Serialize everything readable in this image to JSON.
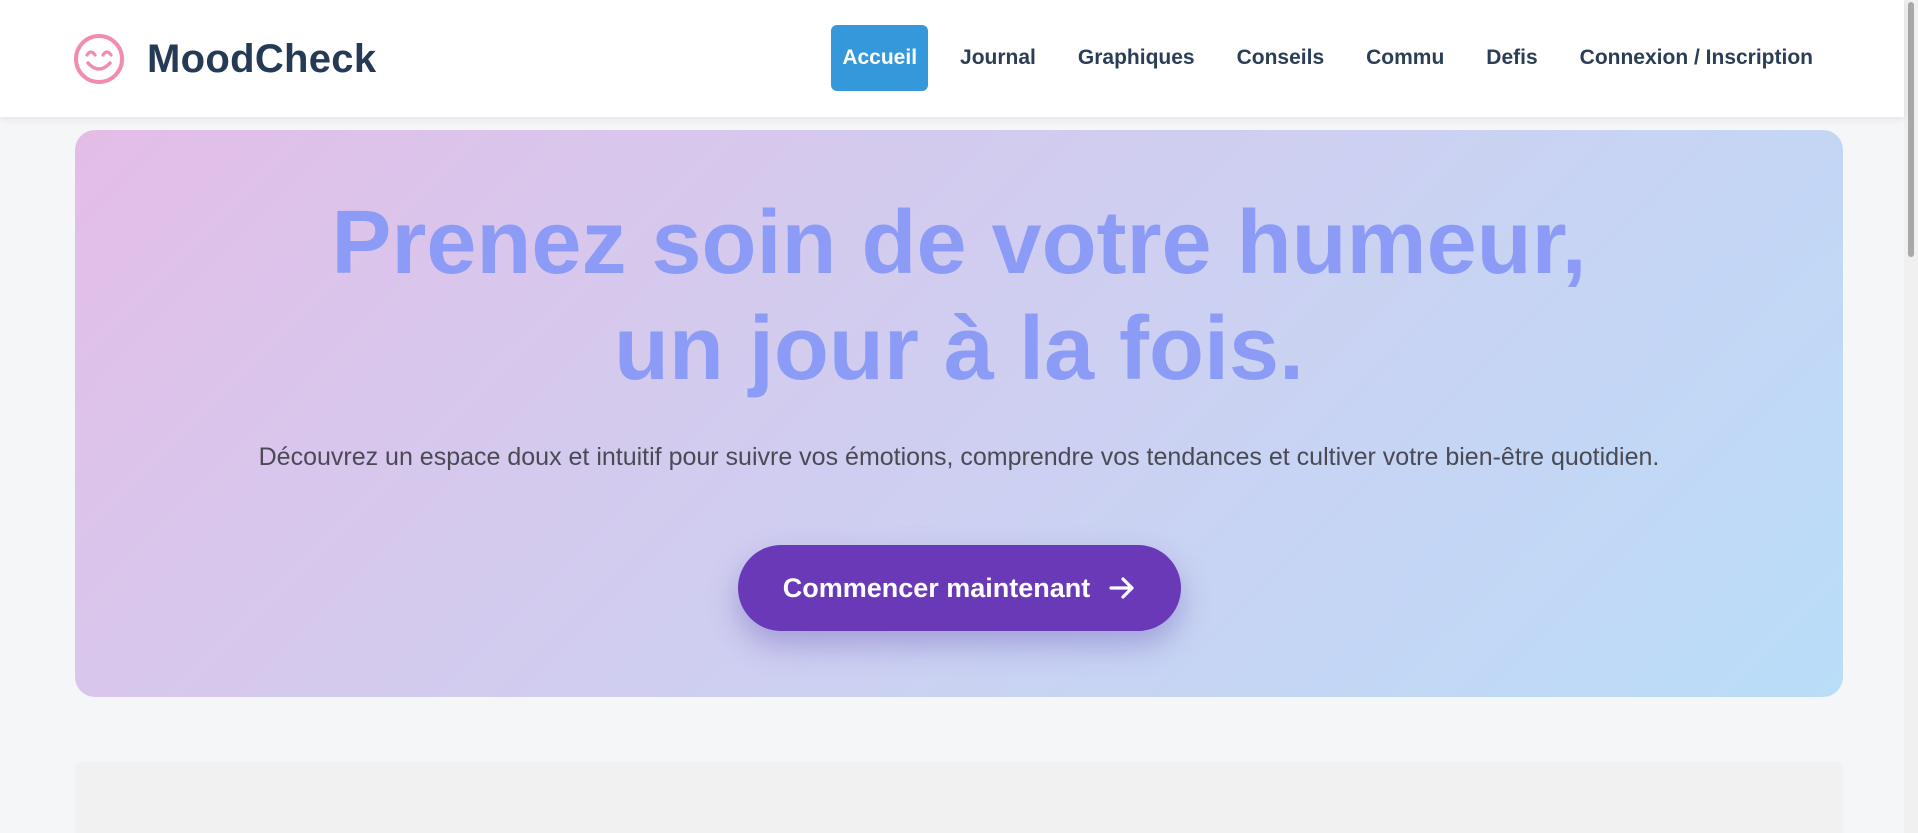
{
  "brand": {
    "name": "MoodCheck",
    "icon": "smiling-face-icon",
    "icon_color": "#f28bb0"
  },
  "nav": {
    "items": [
      {
        "label": "Accueil",
        "active": true
      },
      {
        "label": "Journal",
        "active": false
      },
      {
        "label": "Graphiques",
        "active": false
      },
      {
        "label": "Conseils",
        "active": false
      },
      {
        "label": "Commu",
        "active": false
      },
      {
        "label": "Defis",
        "active": false
      },
      {
        "label": "Connexion / Inscription",
        "active": false
      }
    ],
    "active_color": "#3498db"
  },
  "hero": {
    "title_line1": "Prenez soin de votre humeur,",
    "title_line2": "un jour à la fois.",
    "subtitle": "Découvrez un espace doux et intuitif pour suivre vos émotions, comprendre vos tendances et cultiver votre bien-être quotidien.",
    "cta_label": "Commencer maintenant",
    "cta_icon": "arrow-right-icon",
    "title_color": "#8c9cf6",
    "cta_color": "#6939b8"
  }
}
